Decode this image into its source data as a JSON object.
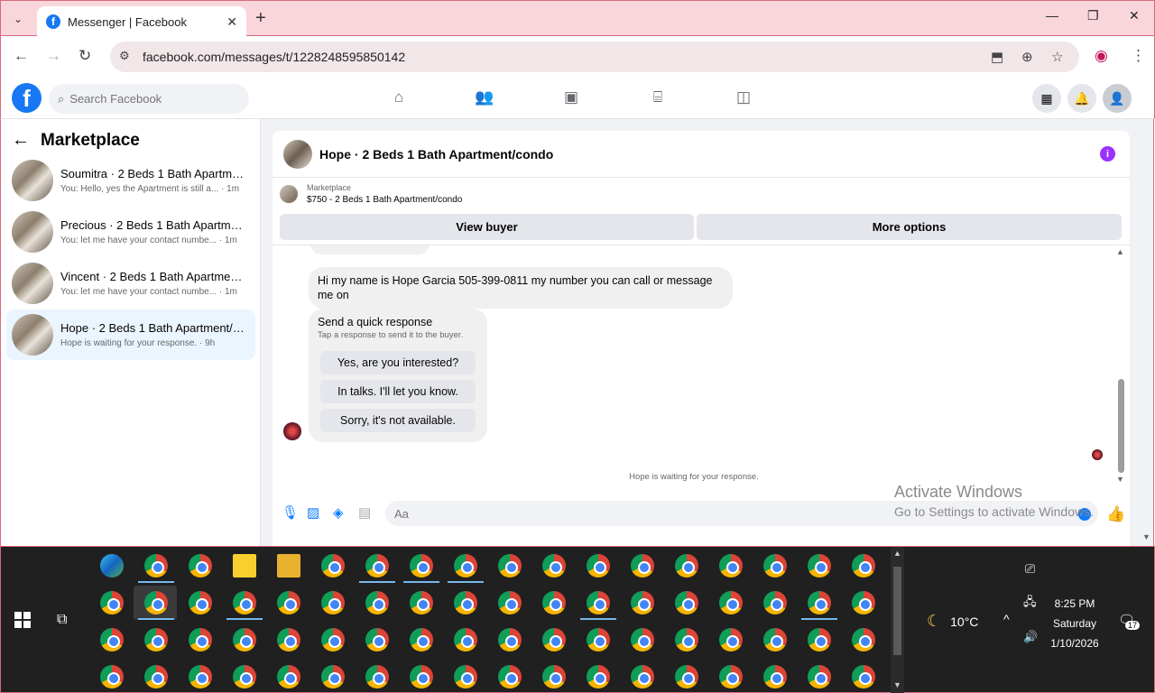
{
  "browser": {
    "tab_title": "Messenger | Facebook",
    "favicon_letter": "f",
    "url": "facebook.com/messages/t/1228248595850142",
    "new_tab": "+",
    "close_tab": "✕"
  },
  "fb": {
    "logo_letter": "f",
    "search_placeholder": "Search Facebook"
  },
  "sidebar": {
    "title": "Marketplace",
    "conversations": [
      {
        "name": "Soumitra · 2 Beds 1 Bath Apartme...",
        "preview": "You: Hello, yes the Apartment is still a... · 1m"
      },
      {
        "name": "Precious · 2 Beds 1 Bath Apartmen...",
        "preview": "You: let me have your contact numbe... · 1m"
      },
      {
        "name": "Vincent · 2 Beds 1 Bath Apartment...",
        "preview": "You: let me have your contact numbe... · 1m"
      },
      {
        "name": "Hope · 2 Beds 1 Bath Apartment/c...",
        "preview": "Hope is waiting for your response. · 9h"
      }
    ]
  },
  "chat": {
    "title": "Hope · 2 Beds 1 Bath Apartment/condo",
    "info_icon": "i",
    "marketplace_label": "Marketplace",
    "listing": "$750 - 2 Beds 1 Bath Apartment/condo",
    "view_buyer": "View buyer",
    "more_options": "More options",
    "message": "Hi my name is Hope Garcia 505-399-0811 my number you can call or message me on",
    "quick_title": "Send a quick response",
    "quick_subtitle": "Tap a response to send it to the buyer.",
    "quick_responses": [
      "Yes, are you interested?",
      "In talks. I'll let you know.",
      "Sorry, it's not available."
    ],
    "waiting": "Hope is waiting for your response.",
    "input_placeholder": "Aa"
  },
  "watermark": {
    "line1": "Activate Windows",
    "line2": "Go to Settings to activate Windows."
  },
  "taskbar": {
    "weather": "10°C",
    "time": "8:25 PM",
    "day": "Saturday",
    "date": "1/10/2026",
    "notifications": "17"
  }
}
